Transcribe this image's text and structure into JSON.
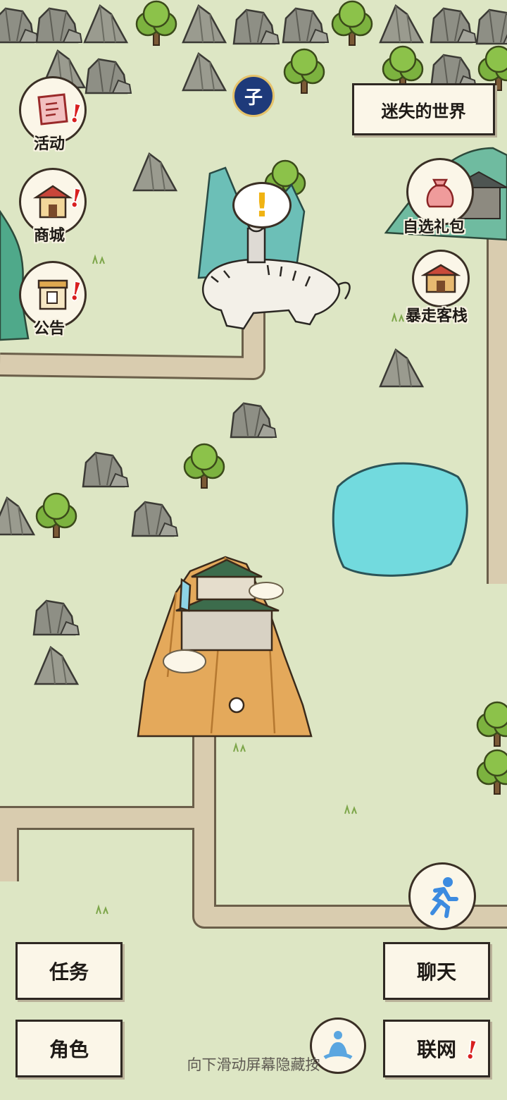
{
  "map": {
    "region_name": "迷失的世界",
    "npc_alert": "!",
    "badge_glyph": "子"
  },
  "left_menu": [
    {
      "label": "活动",
      "icon": "scroll-icon",
      "has_alert": true
    },
    {
      "label": "商城",
      "icon": "shop-icon",
      "has_alert": true
    },
    {
      "label": "公告",
      "icon": "notice-board-icon",
      "has_alert": true
    }
  ],
  "right_menu": [
    {
      "label": "自选礼包",
      "icon": "gift-bag-icon"
    },
    {
      "label": "暴走客栈",
      "icon": "inn-icon"
    }
  ],
  "bottom_left": {
    "quest": "任务",
    "character": "角色"
  },
  "bottom_right": {
    "chat": "聊天",
    "online": "联网"
  },
  "hint": "向下滑动屏幕隐藏按",
  "alert_glyph": "!",
  "colors": {
    "grass": "#dde6c4",
    "path": "#d9ccaf",
    "lake": "#6fd9de",
    "alert": "#d81f1f"
  }
}
